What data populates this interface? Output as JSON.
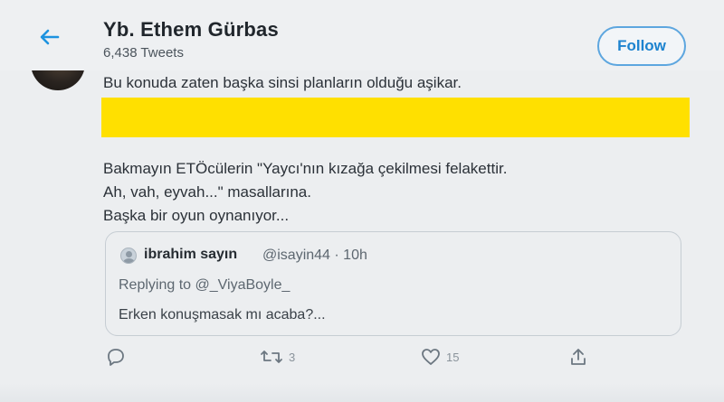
{
  "header": {
    "title": "Yb. Ethem Gürbas",
    "tweet_count": "6,438 Tweets",
    "follow_label": "Follow"
  },
  "tweet": {
    "lines": [
      "Bu konuda zaten başka sinsi planların olduğu aşikar.",
      "Bakmayın ETÖcülerin \"Yaycı'nın kızağa çekilmesi felakettir.",
      "Ah, vah, eyvah...\" masallarına.",
      "Başka bir oyun oynanıyor..."
    ],
    "redaction_color": "#ffe000"
  },
  "quote": {
    "name": "ibrahim sayın",
    "handle_time": "@isayin44 · 10h",
    "replying": "Replying to @_ViyaBoyle_",
    "body": "Erken konuşmasak mı acaba?..."
  },
  "actions": {
    "retweets": "3",
    "likes": "15"
  },
  "colors": {
    "accent": "#1d93e0",
    "background": "#eceef0"
  },
  "icons": [
    "back-arrow-icon",
    "reply-icon",
    "retweet-icon",
    "like-icon",
    "share-icon"
  ]
}
